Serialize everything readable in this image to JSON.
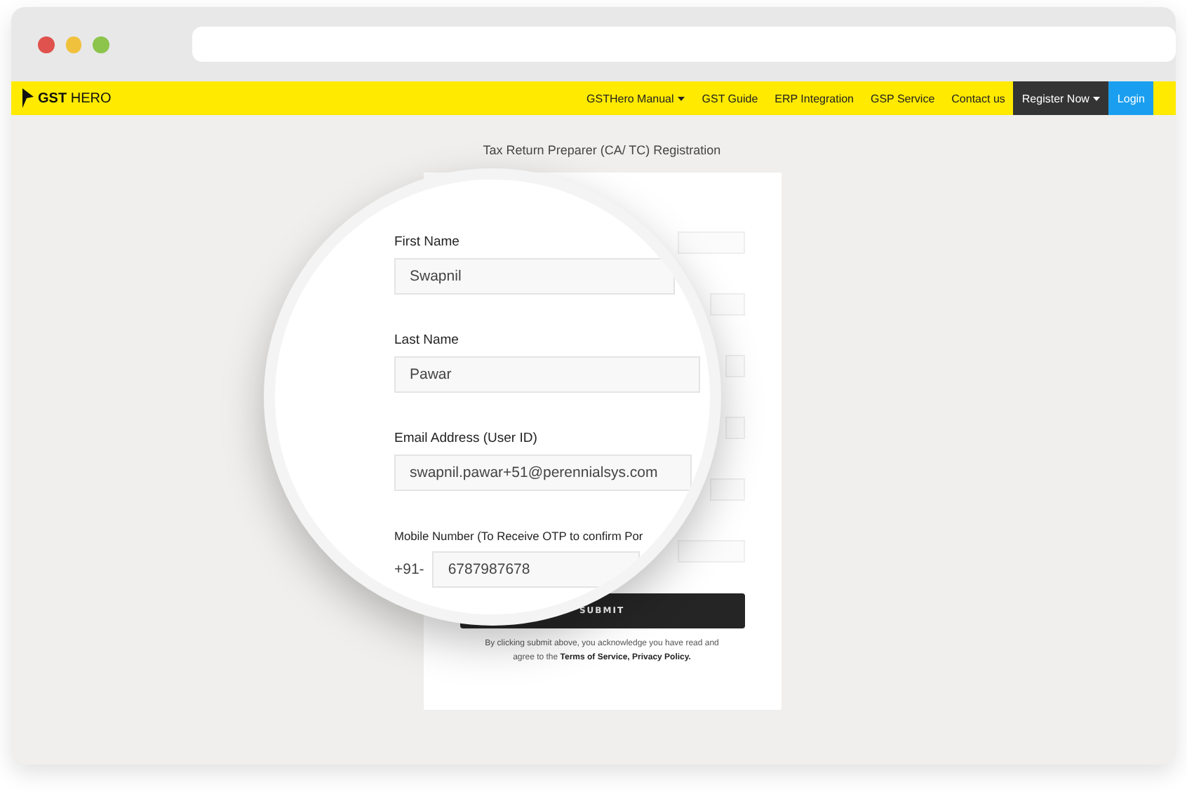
{
  "navbar": {
    "logo": "**GST** HERO",
    "items": [
      {
        "kind": "link",
        "label": "GSTHero Manual",
        "dropdown": true
      },
      {
        "kind": "link",
        "label": "GST Guide",
        "dropdown": false
      },
      {
        "kind": "link",
        "label": "ERP Integration",
        "dropdown": false
      },
      {
        "kind": "link",
        "label": "GSP Service",
        "dropdown": false
      },
      {
        "kind": "link",
        "label": "Contact us",
        "dropdown": false
      },
      {
        "kind": "register",
        "label": "Register Now",
        "dropdown": true
      },
      {
        "kind": "login",
        "label": "Login",
        "dropdown": false
      }
    ]
  },
  "page": {
    "title": "Tax Return Preparer (CA/ TC) Registration"
  },
  "form": {
    "submit": "SUBMIT",
    "terms": "By clicking submit above, you acknowledge you have read and agree to the **Terms of Service, Privacy Policy.**"
  },
  "magnifier": {
    "fields": [
      {
        "label": "First Name",
        "value": "Swapnil"
      },
      {
        "label": "Last Name",
        "value": "Pawar"
      },
      {
        "label": "Email Address (User ID)",
        "value": "swapnil.pawar+51@perennialsys.com"
      },
      {
        "label": "Mobile Number (To Receive OTP to confirm Por",
        "prefix": "+91-",
        "value": "6787987678"
      }
    ]
  }
}
